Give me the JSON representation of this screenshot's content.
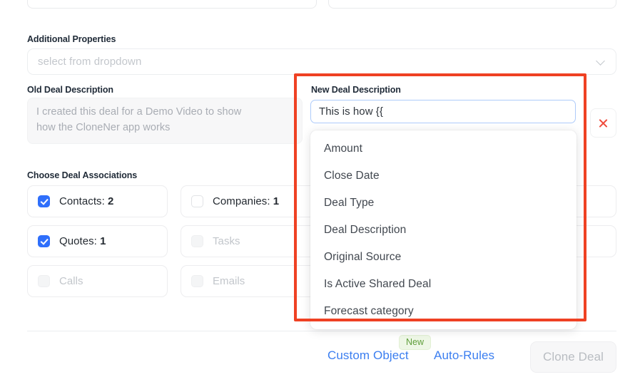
{
  "form": {
    "additional_properties": {
      "label": "Additional Properties",
      "placeholder": "select from dropdown",
      "chevron_icon": "chevron-down-icon"
    },
    "old_deal_description": {
      "label": "Old Deal Description",
      "value": "I created this deal for a Demo Video to show\nhow the CloneNer app works"
    },
    "new_deal_description": {
      "label": "New Deal Description",
      "value": "This is how {{",
      "remove_icon": "close-icon",
      "focus_border_color": "#aecbfa"
    },
    "deal_associations": {
      "label": "Choose Deal Associations",
      "items": [
        {
          "label": "Contacts: ",
          "count": "2",
          "checked": true,
          "disabled": false
        },
        {
          "label": "Companies: ",
          "count": "1",
          "checked": false,
          "disabled": false
        },
        {
          "label": "",
          "count": "",
          "checked": false,
          "disabled": true
        },
        {
          "label": "Quotes: ",
          "count": "1",
          "checked": true,
          "disabled": false
        },
        {
          "label": "Tasks",
          "count": "",
          "checked": false,
          "disabled": true
        },
        {
          "label": "",
          "count": "",
          "checked": false,
          "disabled": true
        },
        {
          "label": "Calls",
          "count": "",
          "checked": false,
          "disabled": true
        },
        {
          "label": "Emails",
          "count": "",
          "checked": false,
          "disabled": true
        },
        {
          "label": "",
          "count": "",
          "checked": false,
          "disabled": true
        }
      ]
    }
  },
  "token_dropdown": {
    "options": [
      "Amount",
      "Close Date",
      "Deal Type",
      "Deal Description",
      "Original Source",
      "Is Active Shared Deal",
      "Forecast category"
    ]
  },
  "footer": {
    "new_badge": "New",
    "custom_object_link": "Custom Object",
    "auto_rules_link": "Auto-Rules",
    "clone_deal_button": "Clone Deal"
  },
  "annotation": {
    "color": "#ef4123"
  }
}
